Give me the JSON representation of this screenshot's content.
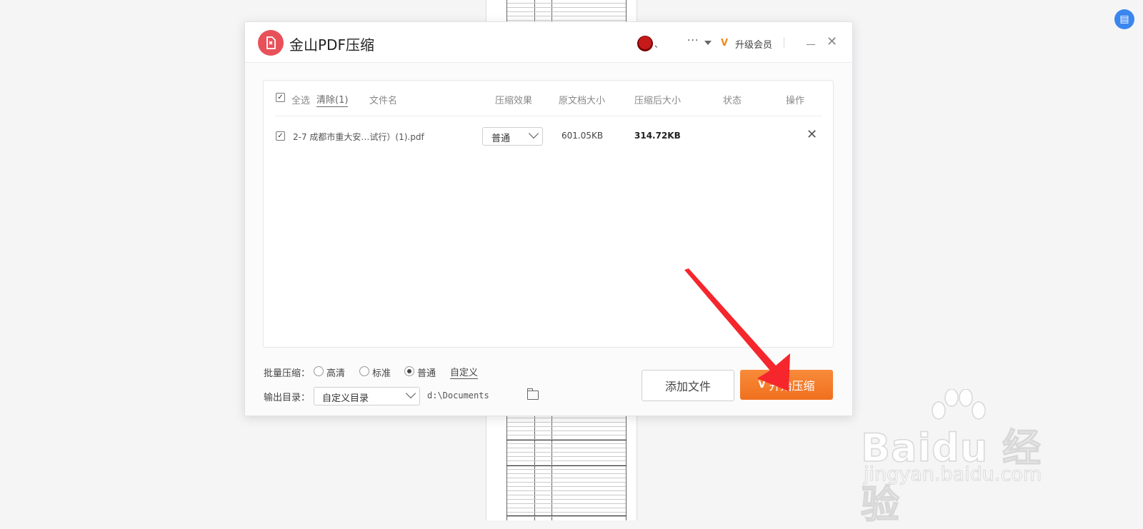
{
  "app": {
    "title": "金山PDF压缩",
    "user_name": "、",
    "more": "···",
    "upgrade": "升级会员",
    "vip_mark": "V"
  },
  "table": {
    "select_all": "全选",
    "clear": "清除(1)",
    "columns": [
      "文件名",
      "压缩效果",
      "原文档大小",
      "压缩后大小",
      "状态",
      "操作"
    ],
    "rows": [
      {
        "checked": true,
        "file_name": "2-7 成都市重大安…试行）(1).pdf",
        "effect": "普通",
        "original_size": "601.05KB",
        "compressed_size": "314.72KB",
        "status": ""
      }
    ]
  },
  "batch": {
    "label": "批量压缩：",
    "options": [
      "高清",
      "标准",
      "普通"
    ],
    "selected": "普通",
    "custom": "自定义"
  },
  "output": {
    "label": "输出目录：",
    "select_value": "自定义目录",
    "path": "d:\\Documents"
  },
  "buttons": {
    "add_file": "添加文件",
    "start": "开始压缩"
  },
  "watermark": {
    "brand": "Baidu 经验",
    "url": "jingyan.baidu.com"
  },
  "colors": {
    "accent": "#f0701f",
    "arrow": "#f5262c",
    "logo": "#e8515a"
  }
}
